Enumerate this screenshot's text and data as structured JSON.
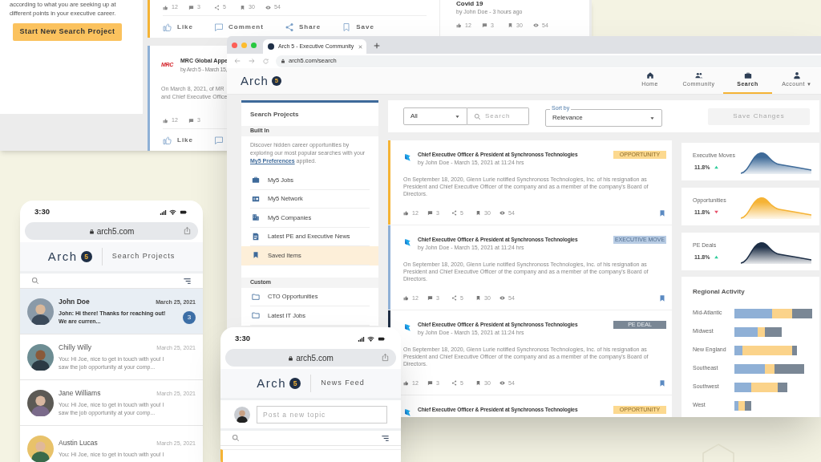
{
  "back_screen": {
    "intro": {
      "text": "according to what you are seeking up at different points in your executive career.",
      "button": "Start New Search Project"
    },
    "posts": [
      {
        "color": "#f5b335",
        "stats": {
          "likes": "12",
          "comments": "3",
          "shares": "5",
          "saves": "30",
          "views": "54"
        },
        "actions": [
          {
            "kind": "like",
            "label": "Like"
          },
          {
            "kind": "comment",
            "label": "Comment"
          },
          {
            "kind": "share",
            "label": "Share"
          },
          {
            "kind": "save",
            "label": "Save"
          }
        ]
      },
      {
        "color": "#8fb0d6",
        "logo": "MRC",
        "title": "MRC Global Appe",
        "byline": "by Arch 5 - March 15,",
        "body": [
          "On March 8, 2021, of MR",
          "and Chief Executive Office"
        ],
        "stats": {
          "likes": "12",
          "comments": "3"
        },
        "actions": [
          {
            "kind": "like",
            "label": "Like"
          },
          {
            "kind": "comment"
          }
        ]
      }
    ],
    "side_post": {
      "title": "Covid 19",
      "byline": "by John Doe - 3 hours ago",
      "stats": {
        "likes": "12",
        "comments": "3",
        "saves": "30",
        "views": "54"
      }
    }
  },
  "browser": {
    "tab": {
      "title": "Arch 5 - Executive Community"
    },
    "url": "arch5.com/search",
    "logo": {
      "text": "Arch",
      "badge": "5"
    },
    "nav": [
      {
        "kind": "home",
        "label": "Home",
        "selected": false
      },
      {
        "kind": "community",
        "label": "Community",
        "selected": false
      },
      {
        "kind": "search",
        "label": "Search",
        "selected": true
      },
      {
        "kind": "account",
        "label": "Account",
        "caret": "▼",
        "selected": false
      }
    ],
    "sidebar": {
      "title": "Search Projects",
      "sections": [
        {
          "heading": "Built In",
          "description": {
            "before": "Discover hidden career opportunities by exploring our most popular searches with your",
            "link": "My5 Preferences",
            "after": "applied."
          },
          "items": [
            {
              "kind": "jobs",
              "label": "My5 Jobs",
              "selected": false
            },
            {
              "kind": "network",
              "label": "My5 Network",
              "selected": false
            },
            {
              "kind": "companies",
              "label": "My5 Companies",
              "selected": false
            },
            {
              "kind": "news",
              "label": "Latest PE and Executive News",
              "selected": false
            },
            {
              "kind": "saved",
              "label": "Saved Items",
              "selected": true
            }
          ]
        },
        {
          "heading": "Custom",
          "items": [
            {
              "kind": "folder",
              "label": "CTO Opportunities",
              "selected": false
            },
            {
              "kind": "folder",
              "label": "Latest IT Jobs",
              "selected": false
            }
          ]
        }
      ]
    },
    "toolbar": {
      "filter": "All",
      "search_placeholder": "Search",
      "sort_label": "Sort by",
      "sort_value": "Relevance",
      "save_button": {
        "label": "Save Changes",
        "disabled": true
      }
    },
    "feed": [
      {
        "color": "#f5b335",
        "title": "Chief Executive Officer & President at Synchronoss Technologies",
        "byline": "by John Doe - March 15, 2021 at 11:24 hrs",
        "tag": {
          "label": "OPPORTUNITY",
          "color": "#fcd98f"
        },
        "body": "On September 18, 2020, Glenn Lurie notified Synchronoss Technologies, Inc. of his resignation as President and Chief Executive Officer of the company and as a member of the company's Board of Directors.",
        "stats": {
          "likes": "12",
          "comments": "3",
          "shares": "5",
          "saves": "30",
          "views": "54"
        },
        "saved": true
      },
      {
        "color": "#8fb0d6",
        "title": "Chief Executive Officer & President at Synchronoss Technologies",
        "byline": "by John Doe - March 15, 2021 at 11:24 hrs",
        "tag": {
          "label": "EXECUTIVE MOVE",
          "color": "#b8cce4"
        },
        "body": "On September 18, 2020, Glenn Lurie notified Synchronoss Technologies, Inc. of his resignation as President and Chief Executive Officer of the company and as a member of the company's Board of Directors.",
        "stats": {
          "likes": "12",
          "comments": "3",
          "shares": "5",
          "saves": "30",
          "views": "54"
        },
        "saved": true
      },
      {
        "color": "#1f2e44",
        "title": "Chief Executive Officer & President at Synchronoss Technologies",
        "byline": "by John Doe - March 15, 2021 at 11:24 hrs",
        "tag": {
          "label": "PE DEAL",
          "color": "#7a8795"
        },
        "body": "On September 18, 2020, Glenn Lurie notified Synchronoss Technologies, Inc. of his resignation as President and Chief Executive Officer of the company and as a member of the company's Board of Directors.",
        "stats": {
          "likes": "12",
          "comments": "3",
          "shares": "5",
          "saves": "30",
          "views": "54"
        },
        "saved": true
      },
      {
        "title": "Chief Executive Officer & President at Synchronoss Technologies",
        "tag": {
          "label": "OPPORTUNITY",
          "color": "#fcd98f"
        }
      }
    ],
    "trends": [
      {
        "label": "Executive Moves",
        "value": "11.8%",
        "rising": true,
        "color": "#3f6b99"
      },
      {
        "label": "Opportunities",
        "value": "11.8%",
        "rising": false,
        "color": "#f5b335"
      },
      {
        "label": "PE Deals",
        "value": "11.8%",
        "rising": true,
        "color": "#1e2f47"
      }
    ],
    "regional": {
      "title": "Regional Activity",
      "regions": [
        "Mid-Atlantic",
        "Midwest",
        "New England",
        "Southeast",
        "Southwest",
        "West"
      ]
    }
  },
  "chat_phone": {
    "time": "3:30",
    "url": "arch5.com",
    "logo": {
      "text": "Arch",
      "badge": "5"
    },
    "page_title": "Search Projects",
    "conversations": [
      {
        "name": "John Doe",
        "date": "March 25, 2021",
        "preview": "John: Hi there! Thanks for reaching out! We are curren...",
        "unread": "3",
        "selected": true
      },
      {
        "name": "Chilly Willy",
        "date": "March 25, 2021",
        "preview": "You: Hi Joe, nice to get in touch with you! I saw the job opportunity at your comp...",
        "selected": false
      },
      {
        "name": "Jane Williams",
        "date": "March 25, 2021",
        "preview": "You: Hi Joe, nice to get in touch with you! I saw the job opportunity at your comp...",
        "selected": false
      },
      {
        "name": "Austin Lucas",
        "date": "March 25, 2021",
        "preview": "You: Hi Joe, nice to get in touch with you! I",
        "selected": false
      }
    ]
  },
  "feed_phone": {
    "time": "3:30",
    "url": "arch5.com",
    "logo": {
      "text": "Arch",
      "badge": "5"
    },
    "page_title": "News Feed",
    "composer": {
      "placeholder": "Post a new topic"
    }
  }
}
